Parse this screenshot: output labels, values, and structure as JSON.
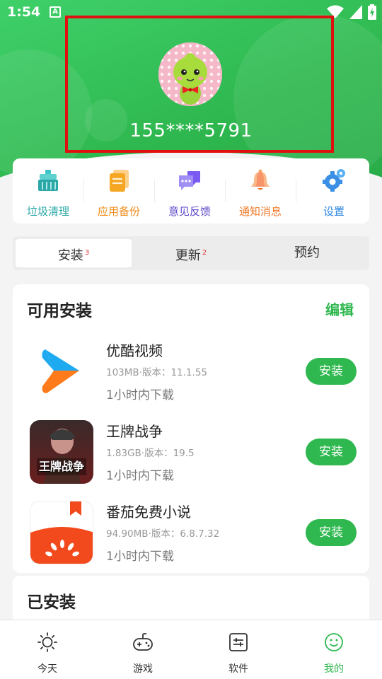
{
  "status_bar": {
    "time": "1:54",
    "notification": "A"
  },
  "profile": {
    "phone": "155****5791"
  },
  "quick_actions": [
    {
      "label": "垃圾清理",
      "icon": "broom-icon",
      "color": "#2aa7a7"
    },
    {
      "label": "应用备份",
      "icon": "backup-icon",
      "color": "#f08c1a"
    },
    {
      "label": "意见反馈",
      "icon": "feedback-icon",
      "color": "#5b48c9"
    },
    {
      "label": "通知消息",
      "icon": "bell-icon",
      "color": "#f07a2a"
    },
    {
      "label": "设置",
      "icon": "gear-icon",
      "color": "#2b86e0"
    }
  ],
  "tabs": [
    {
      "label": "安装",
      "badge": "3"
    },
    {
      "label": "更新",
      "badge": "2"
    },
    {
      "label": "预约",
      "badge": ""
    }
  ],
  "available": {
    "title": "可用安装",
    "edit_label": "编辑",
    "apps": [
      {
        "name": "优酷视频",
        "meta": "103MB·版本：11.1.55",
        "time": "1小时内下载",
        "button": "安装"
      },
      {
        "name": "王牌战争",
        "meta": "1.83GB·版本：19.5",
        "time": "1小时内下载",
        "button": "安装"
      },
      {
        "name": "番茄免费小说",
        "meta": "94.90MB·版本：6.8.7.32",
        "time": "1小时内下载",
        "button": "安装"
      }
    ],
    "game_icon_text": "王牌战争"
  },
  "installed": {
    "title": "已安装"
  },
  "bottom_nav": [
    {
      "label": "今天",
      "icon": "sun-icon"
    },
    {
      "label": "游戏",
      "icon": "gamepad-icon"
    },
    {
      "label": "软件",
      "icon": "software-icon"
    },
    {
      "label": "我的",
      "icon": "smile-icon",
      "active": true
    }
  ]
}
